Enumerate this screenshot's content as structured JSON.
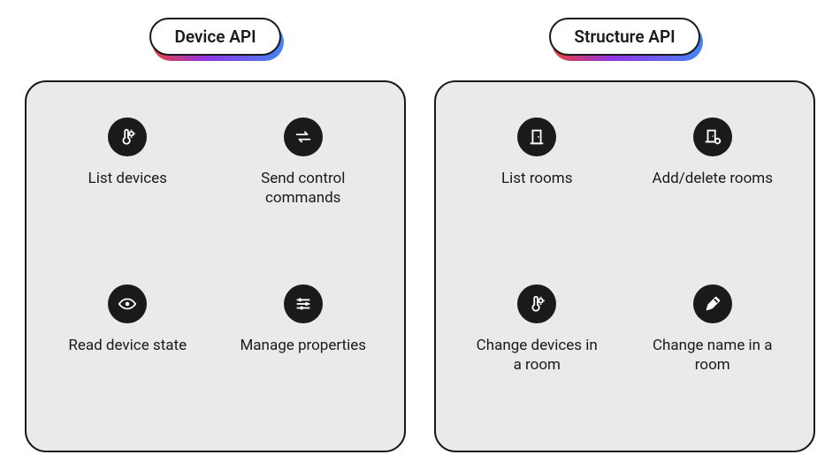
{
  "columns": [
    {
      "title": "Device API",
      "features": [
        {
          "icon": "thermo-light",
          "label": "List devices"
        },
        {
          "icon": "arrows",
          "label": "Send control commands"
        },
        {
          "icon": "eye",
          "label": "Read device state"
        },
        {
          "icon": "sliders",
          "label": "Manage properties"
        }
      ]
    },
    {
      "title": "Structure API",
      "features": [
        {
          "icon": "door",
          "label": "List rooms"
        },
        {
          "icon": "door-gear",
          "label": "Add/delete rooms"
        },
        {
          "icon": "thermo-light",
          "label": "Change devices in a room"
        },
        {
          "icon": "pencil",
          "label": "Change name in a room"
        }
      ]
    }
  ]
}
